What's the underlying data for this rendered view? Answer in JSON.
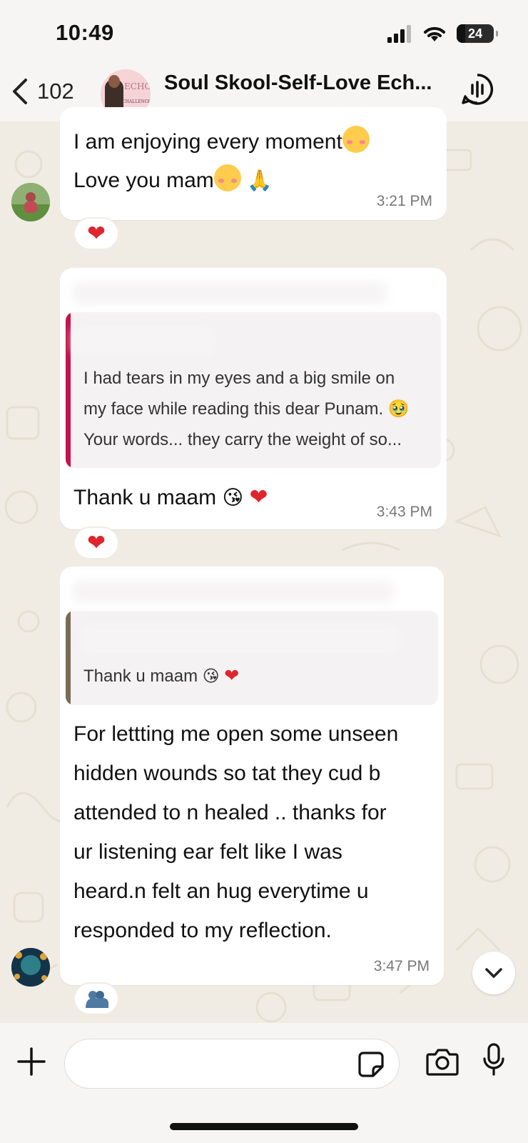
{
  "status_bar": {
    "time": "10:49",
    "battery": "24"
  },
  "header": {
    "back_count": "102",
    "group_title": "Soul Skool-Self-Love Ech...",
    "avatar_text": "ECHO",
    "avatar_subtext": "CHALLENGE"
  },
  "messages": [
    {
      "line1": "I am enjoying every moment",
      "line2": "Love you mam",
      "time": "3:21 PM",
      "reaction": "heart"
    },
    {
      "quote": "I had tears in my eyes and a big smile on my face while reading this dear Punam. 🥹 Your words... they carry the weight of so...",
      "quote_lines": [
        "I had tears in my eyes and a big smile on",
        "my face while reading this dear Punam. 🥹",
        "Your words... they carry the weight of so..."
      ],
      "text": "Thank u maam",
      "time": "3:43 PM",
      "reaction": "heart"
    },
    {
      "quote": "Thank u maam 😘 ❤️",
      "quote_text": "Thank u maam",
      "lines": [
        "For lettting me open some unseen",
        "hidden wounds so tat they cud b",
        "attended to n healed ..  thanks for",
        "ur listening ear felt like I was",
        "heard.n felt an hug everytime u",
        "responded to my reflection."
      ],
      "time": "3:47 PM",
      "reaction": "hug"
    }
  ],
  "colors": {
    "quote_bar_1": "#c2134a",
    "quote_bar_2": "#7b6a55",
    "heart": "#e0252c",
    "wallpaper": "#f1ece3"
  },
  "icons": [
    "back-chevron-icon",
    "voice-chat-icon",
    "plus-icon",
    "sticker-icon",
    "camera-icon",
    "microphone-icon",
    "chevron-down-icon"
  ]
}
